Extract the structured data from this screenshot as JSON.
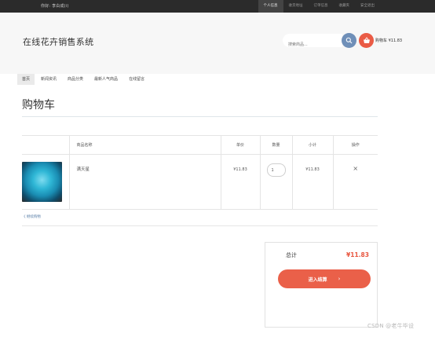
{
  "topbar": {
    "greeting": "你好: 李白成(i)",
    "links": [
      "个人信息",
      "收货地址",
      "订单信息",
      "收藏夹",
      "安全退出"
    ]
  },
  "header": {
    "site_title": "在线花卉销售系统",
    "search_placeholder": "搜索商品...",
    "cart_summary": "购物车 ¥11.83"
  },
  "nav": {
    "items": [
      "首页",
      "新闻资讯",
      "商品分类",
      "最新人气商品",
      "在线留言"
    ]
  },
  "main": {
    "heading": "购物车",
    "table": {
      "headers": [
        "",
        "商品名称",
        "单价",
        "数量",
        "小计",
        "操作"
      ],
      "rows": [
        {
          "name": "满天星",
          "price": "¥11.83",
          "quantity": "1",
          "subtotal": "¥11.83",
          "action": "×"
        }
      ]
    },
    "continue_shopping": "《 继续购物",
    "summary": {
      "total_label": "总计",
      "total_value": "¥11.83",
      "checkout_label": "进入结算",
      "checkout_arrow": "›"
    }
  },
  "watermark": "CSDN @老牛毕设",
  "colors": {
    "topbar_bg": "#2b2b2b",
    "header_bg": "#f7f7f7",
    "accent_orange": "#ea6049",
    "search_blue": "#6f8fb8"
  }
}
